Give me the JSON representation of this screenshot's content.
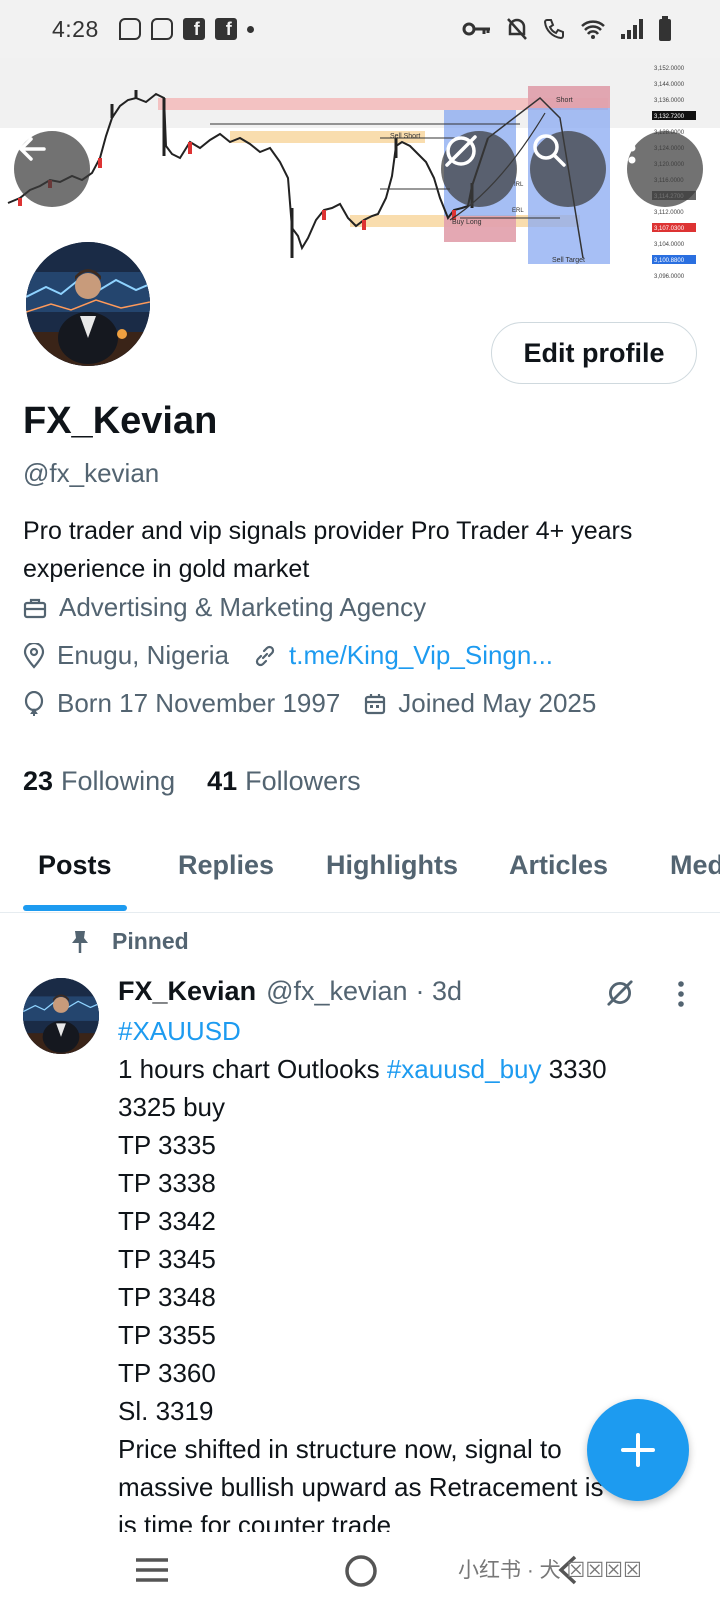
{
  "status_bar": {
    "time": "4:28"
  },
  "profile": {
    "display_name": "FX_Kevian",
    "handle": "@fx_kevian",
    "bio": "Pro trader and vip signals provider Pro Trader 4+ years experience in gold market",
    "category": "Advertising & Marketing Agency",
    "location": "Enugu, Nigeria",
    "website": "t.me/King_Vip_Singn...",
    "birthday": "Born 17 November 1997",
    "joined": "Joined May 2025",
    "following_count": "23",
    "following_label": "Following",
    "followers_count": "41",
    "followers_label": "Followers",
    "edit_profile_label": "Edit profile"
  },
  "banner_chart_labels": {
    "sell_short": "Sell Short",
    "buy_long": "Buy Long",
    "sell_target": "Sell Target",
    "irl": "IRL",
    "erl": "ERL",
    "short": "Short",
    "prices": [
      "3,152.0000",
      "3,144.0000",
      "3,136.0000",
      "3,132.7200",
      "3,128.0000",
      "3,124.0000",
      "3,120.0000",
      "3,116.0000",
      "3,114.2700",
      "3,112.0000",
      "3,107.0300",
      "3,104.0000",
      "3,100.8800",
      "3,096.0000"
    ]
  },
  "tabs": [
    {
      "label": "Posts",
      "active": true
    },
    {
      "label": "Replies",
      "active": false
    },
    {
      "label": "Highlights",
      "active": false
    },
    {
      "label": "Articles",
      "active": false
    },
    {
      "label": "Media",
      "active": false
    }
  ],
  "post": {
    "pinned_label": "Pinned",
    "author_name": "FX_Kevian",
    "author_handle": "@fx_kevian",
    "time": "· 3d",
    "hashtag": "#XAUUSD",
    "line1_text": "1 hours chart Outlooks ",
    "line1_tag": "#xauusd_buy",
    "line1_tail": " 3330",
    "lines": [
      "3325 buy",
      "TP 3335",
      "TP 3338",
      "TP 3342",
      "TP 3345",
      "TP 3348",
      "TP 3355",
      "TP 3360",
      "Sl.  3319",
      "Price shifted in structure now, signal to",
      "massive bullish upward as Retracement is",
      "is time for counter trade"
    ]
  },
  "watermark": "小红书 · 犬 ☒☒☒☒",
  "colors": {
    "accent": "#1d9bf0",
    "text_primary": "#0f1419",
    "text_secondary": "#536471"
  }
}
